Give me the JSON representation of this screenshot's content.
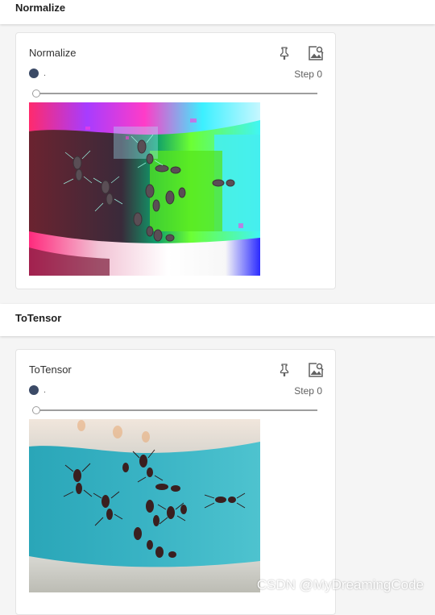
{
  "sections": [
    {
      "header": "Normalize",
      "card": {
        "title": "Normalize",
        "run_name": ".",
        "run_color": "#3b4a66",
        "step_label": "Step 0",
        "pin_icon": "pin-icon",
        "fit_icon": "image-fit-icon",
        "image_kind": "normalized"
      }
    },
    {
      "header": "ToTensor",
      "card": {
        "title": "ToTensor",
        "run_name": ".",
        "run_color": "#3b4a66",
        "step_label": "Step 0",
        "pin_icon": "pin-icon",
        "fit_icon": "image-fit-icon",
        "image_kind": "tensor"
      }
    }
  ],
  "watermark": "CSDN @MyDreamingCode"
}
